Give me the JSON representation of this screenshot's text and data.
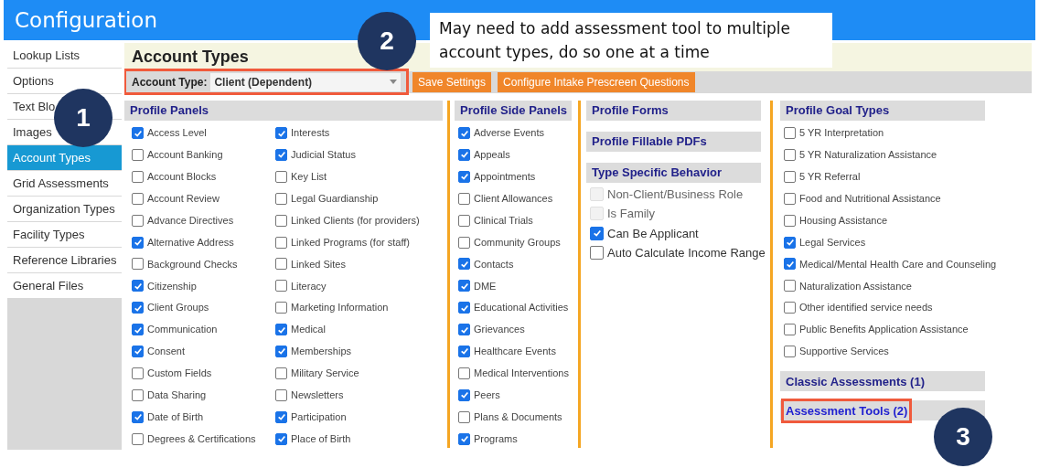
{
  "window": {
    "title": "Configuration"
  },
  "sidebar": {
    "items": [
      {
        "label": "Lookup Lists",
        "selected": false
      },
      {
        "label": "Options",
        "selected": false
      },
      {
        "label": "Text Blo",
        "selected": false
      },
      {
        "label": "Images",
        "selected": false
      },
      {
        "label": "Account Types",
        "selected": true
      },
      {
        "label": "Grid Assessments",
        "selected": false
      },
      {
        "label": "Organization Types",
        "selected": false
      },
      {
        "label": "Facility Types",
        "selected": false
      },
      {
        "label": "Reference Libraries",
        "selected": false
      },
      {
        "label": "General Files",
        "selected": false
      }
    ]
  },
  "page": {
    "title": "Account Types"
  },
  "toolbar": {
    "account_type": {
      "label": "Account Type:",
      "value": "Client (Dependent)",
      "highlighted": true
    },
    "buttons": [
      "Save Settings",
      "Configure Intake Prescreen Questions"
    ]
  },
  "profile_panels": {
    "title": "Profile Panels",
    "columns": [
      {
        "items": [
          {
            "label": "Access Level",
            "checked": true
          },
          {
            "label": "Account Banking",
            "checked": false
          },
          {
            "label": "Account Blocks",
            "checked": false
          },
          {
            "label": "Account Review",
            "checked": false
          },
          {
            "label": "Advance Directives",
            "checked": false
          },
          {
            "label": "Alternative Address",
            "checked": true
          },
          {
            "label": "Background Checks",
            "checked": false
          },
          {
            "label": "Citizenship",
            "checked": true
          },
          {
            "label": "Client Groups",
            "checked": true
          },
          {
            "label": "Communication",
            "checked": true
          },
          {
            "label": "Consent",
            "checked": true
          },
          {
            "label": "Custom Fields",
            "checked": false
          },
          {
            "label": "Data Sharing",
            "checked": false
          },
          {
            "label": "Date of Birth",
            "checked": true
          },
          {
            "label": "Degrees & Certifications",
            "checked": false
          }
        ]
      },
      {
        "items": [
          {
            "label": "Interests",
            "checked": true
          },
          {
            "label": "Judicial Status",
            "checked": true
          },
          {
            "label": "Key List",
            "checked": false
          },
          {
            "label": "Legal Guardianship",
            "checked": false
          },
          {
            "label": "Linked Clients (for providers)",
            "checked": false
          },
          {
            "label": "Linked Programs (for staff)",
            "checked": false
          },
          {
            "label": "Linked Sites",
            "checked": false
          },
          {
            "label": "Literacy",
            "checked": false
          },
          {
            "label": "Marketing Information",
            "checked": false
          },
          {
            "label": "Medical",
            "checked": true
          },
          {
            "label": "Memberships",
            "checked": true
          },
          {
            "label": "Military Service",
            "checked": false
          },
          {
            "label": "Newsletters",
            "checked": false
          },
          {
            "label": "Participation",
            "checked": true
          },
          {
            "label": "Place of Birth",
            "checked": true
          }
        ]
      }
    ]
  },
  "profile_side_panels": {
    "title": "Profile Side Panels",
    "items": [
      {
        "label": "Adverse Events",
        "checked": true
      },
      {
        "label": "Appeals",
        "checked": true
      },
      {
        "label": "Appointments",
        "checked": true
      },
      {
        "label": "Client Allowances",
        "checked": false
      },
      {
        "label": "Clinical Trials",
        "checked": false
      },
      {
        "label": "Community Groups",
        "checked": false
      },
      {
        "label": "Contacts",
        "checked": true
      },
      {
        "label": "DME",
        "checked": true
      },
      {
        "label": "Educational Activities",
        "checked": true
      },
      {
        "label": "Grievances",
        "checked": true
      },
      {
        "label": "Healthcare Events",
        "checked": true
      },
      {
        "label": "Medical Interventions",
        "checked": false
      },
      {
        "label": "Peers",
        "checked": true
      },
      {
        "label": "Plans & Documents",
        "checked": false
      },
      {
        "label": "Programs",
        "checked": true
      }
    ]
  },
  "profile_forms": {
    "title": "Profile Forms"
  },
  "profile_fillable_pdfs": {
    "title": "Profile Fillable PDFs"
  },
  "type_specific_behavior": {
    "title": "Type Specific Behavior",
    "items": [
      {
        "label": "Non-Client/Business Role",
        "checked": false,
        "disabled": true
      },
      {
        "label": "Is Family",
        "checked": false,
        "disabled": true
      },
      {
        "label": "Can Be Applicant",
        "checked": true,
        "disabled": false
      },
      {
        "label": "Auto Calculate Income Range",
        "checked": false,
        "disabled": false
      }
    ]
  },
  "profile_goal_types": {
    "title": "Profile Goal Types",
    "items": [
      {
        "label": "5 YR Interpretation",
        "checked": false
      },
      {
        "label": "5 YR Naturalization Assistance",
        "checked": false
      },
      {
        "label": "5 YR Referral",
        "checked": false
      },
      {
        "label": "Food and Nutritional Assistance",
        "checked": false
      },
      {
        "label": "Housing Assistance",
        "checked": false
      },
      {
        "label": "Legal Services",
        "checked": true
      },
      {
        "label": "Medical/Mental Health Care and Counseling",
        "checked": true
      },
      {
        "label": "Naturalization Assistance",
        "checked": false
      },
      {
        "label": "Other identified service needs",
        "checked": false
      },
      {
        "label": "Public Benefits Application Assistance",
        "checked": false
      },
      {
        "label": "Supportive Services",
        "checked": false
      }
    ]
  },
  "classic_assessments": {
    "title": "Classic Assessments (1)"
  },
  "assessment_tools": {
    "title": "Assessment Tools (2)",
    "highlighted": true
  },
  "annotations": {
    "note": "May need to add assessment tool to multiple account types, do so one at a time",
    "steps": [
      "1",
      "2",
      "3"
    ]
  }
}
